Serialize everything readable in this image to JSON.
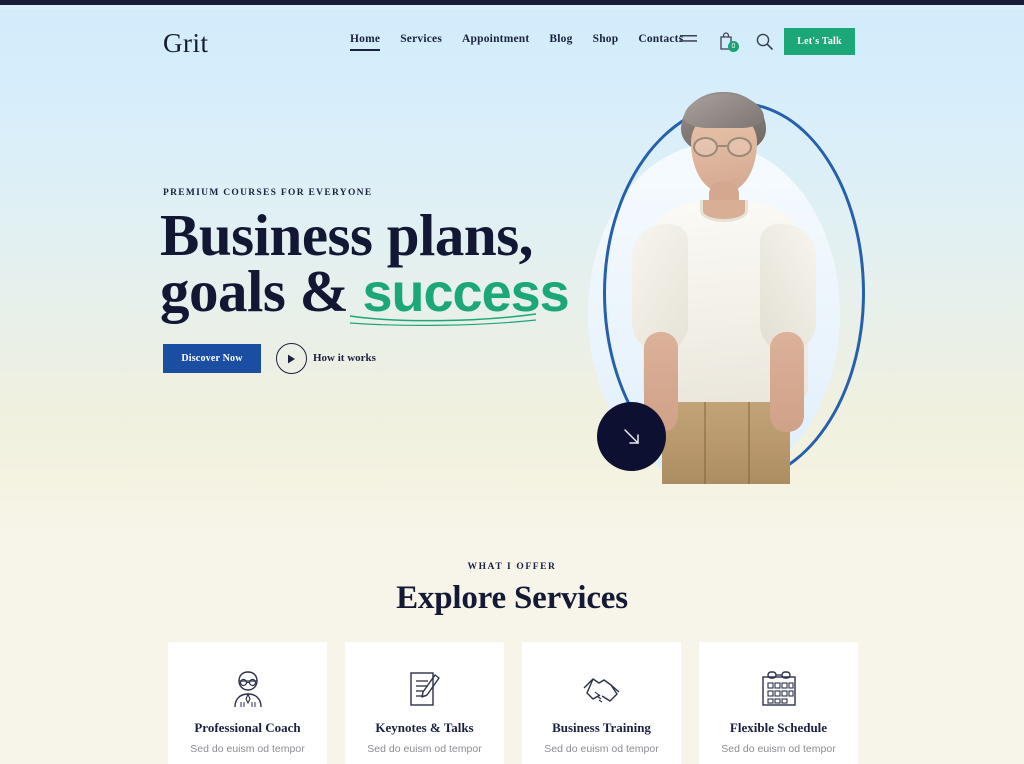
{
  "brand": {
    "logo": "Grit"
  },
  "nav": {
    "items": [
      {
        "label": "Home",
        "active": true
      },
      {
        "label": "Services",
        "active": false
      },
      {
        "label": "Appointment",
        "active": false
      },
      {
        "label": "Blog",
        "active": false
      },
      {
        "label": "Shop",
        "active": false
      },
      {
        "label": "Contacts",
        "active": false
      }
    ]
  },
  "header_tools": {
    "menu_icon": "hamburger-menu-icon",
    "cart_icon": "shopping-bag-icon",
    "cart_count": "0",
    "search_icon": "search-icon",
    "cta_label": "Let's Talk"
  },
  "hero": {
    "eyebrow": "PREMIUM COURSES FOR EVERYONE",
    "headline_line1": "Business plans,",
    "headline_line2_prefix": "goals & ",
    "headline_highlight": "success",
    "primary_button": "Discover Now",
    "play_icon": "play-icon",
    "secondary_label": "How it works",
    "scroll_icon": "arrow-down-right-icon"
  },
  "services": {
    "eyebrow": "WHAT I OFFER",
    "title": "Explore Services",
    "cards": [
      {
        "icon": "coach-person-icon",
        "title": "Professional Coach",
        "desc": "Sed do euism od tempor"
      },
      {
        "icon": "document-pen-icon",
        "title": "Keynotes & Talks",
        "desc": "Sed do euism od tempor"
      },
      {
        "icon": "handshake-icon",
        "title": "Business Training",
        "desc": "Sed do euism od tempor"
      },
      {
        "icon": "calendar-icon",
        "title": "Flexible Schedule",
        "desc": "Sed do euism od tempor"
      }
    ]
  },
  "colors": {
    "accent_green": "#1ba777",
    "accent_blue": "#1a4ea2",
    "ring_blue": "#2660ad",
    "dark_navy": "#0d1030",
    "hero_top": "#d2ecfb",
    "services_bg": "#f7f5ea"
  }
}
